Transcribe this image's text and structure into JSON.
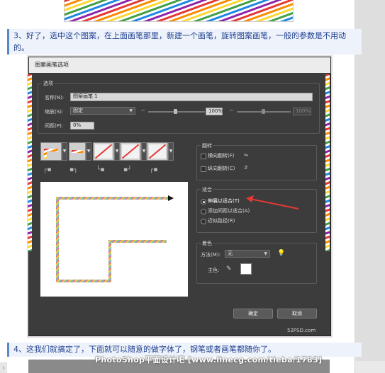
{
  "article": {
    "step3_text": "3、好了，选中这个图案，在上面画笔那里，新建一个画笔，旋转图案画笔，一般的参数是不用动的。",
    "step4_text": "4、这我们就搞定了，下面就可以随意的做字体了，钢笔或者画笔都随你了。",
    "source_watermark": "52PSD.com",
    "footer_watermark": "PhotoShop平面设计吧 [www.linecg.com/tieba/1783]"
  },
  "dialog": {
    "title": "图案画笔选项",
    "options_group": "选项",
    "name_label": "名称(N):",
    "name_value": "图案画笔 1",
    "scale_label": "缩放(S):",
    "scale_value": "固定",
    "scale_percent": "100%",
    "scale_percent2": "100%",
    "spacing_label": "间距(P):",
    "spacing_value": "0%",
    "flip_group": "翻转",
    "flip_horizontal": "横向翻转(F)",
    "flip_vertical": "纵向翻转(C)",
    "fit_group": "适合",
    "fit_stretch": "伸展以适合(T)",
    "fit_add_space": "添加间距以适合(A)",
    "fit_approx_path": "近似路径(R)",
    "color_group": "着色",
    "method_label": "方法(M):",
    "method_value": "无",
    "key_color_label": "主色:",
    "ok_button": "确定",
    "cancel_button": "取消"
  },
  "colors": {
    "dialog_bg": "#3c3c3c",
    "accent_arrow": "#e53935",
    "step_text": "#1f3f8f"
  }
}
